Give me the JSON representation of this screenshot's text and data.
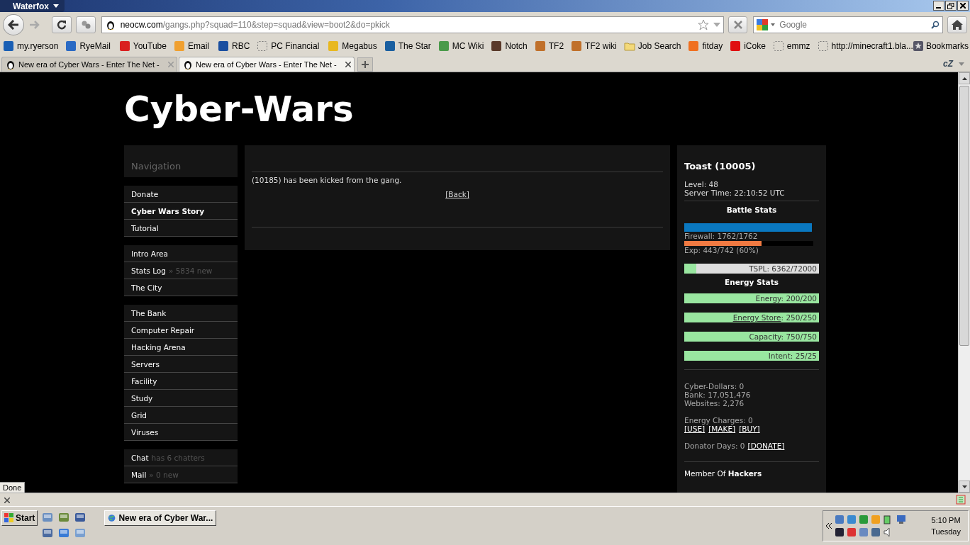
{
  "window": {
    "title": "Waterfox"
  },
  "toolbar": {
    "url_host": "neocw.com",
    "url_path": "/gangs.php?squad=110&step=squad&view=boot2&do=pkick",
    "search_placeholder": "Google"
  },
  "bookmark_groups": [
    [
      {
        "label": "my.ryerson",
        "kind": "favicon",
        "color": "#1a5fb4"
      },
      {
        "label": "RyeMail",
        "kind": "favicon",
        "color": "#2a6ac4"
      }
    ],
    [
      {
        "label": "YouTube",
        "kind": "favicon",
        "color": "#d92020"
      },
      {
        "label": "Email",
        "kind": "favicon",
        "color": "#f0a030"
      }
    ],
    [
      {
        "label": "RBC",
        "kind": "favicon",
        "color": "#1a4fa0"
      },
      {
        "label": "PC Financial",
        "kind": "blank"
      }
    ],
    [
      {
        "label": "Megabus",
        "kind": "favicon",
        "color": "#e8b820"
      },
      {
        "label": "The Star",
        "kind": "favicon",
        "color": "#1a5fa0"
      },
      {
        "label": "MC Wiki",
        "kind": "favicon",
        "color": "#4a9a4a"
      },
      {
        "label": "Notch",
        "kind": "favicon",
        "color": "#5a3a2a"
      },
      {
        "label": "TF2",
        "kind": "favicon",
        "color": "#c0702a"
      },
      {
        "label": "TF2 wiki",
        "kind": "favicon",
        "color": "#c0702a"
      },
      {
        "label": "Job Search",
        "kind": "folder"
      },
      {
        "label": "fitday",
        "kind": "favicon",
        "color": "#f07020"
      },
      {
        "label": "iCoke",
        "kind": "favicon",
        "color": "#e01010"
      },
      {
        "label": "emmz",
        "kind": "blank"
      },
      {
        "label": "http://minecraft1.bla...",
        "kind": "blank"
      }
    ]
  ],
  "bookmarks_menu": "Bookmarks",
  "tabs": [
    {
      "label": "New era of Cyber Wars - Enter The Net -",
      "selected": false
    },
    {
      "label": "New era of Cyber Wars - Enter The Net -",
      "selected": true
    }
  ],
  "addon_badge": "cZ",
  "page": {
    "site_title": "Cyber-Wars",
    "navigation": {
      "heading": "Navigation",
      "groups": [
        [
          {
            "label": "Donate",
            "emphasized": false
          },
          {
            "label": "Cyber Wars Story",
            "emphasized": true
          },
          {
            "label": "Tutorial",
            "emphasized": false
          }
        ],
        [
          {
            "label": "Intro Area",
            "emphasized": false
          },
          {
            "label": "Stats Log",
            "note": "» 5834 new",
            "emphasized": false
          },
          {
            "label": "The City",
            "emphasized": false
          }
        ],
        [
          {
            "label": "The Bank",
            "emphasized": false
          },
          {
            "label": "Computer Repair",
            "emphasized": false
          },
          {
            "label": "Hacking Arena",
            "emphasized": false
          },
          {
            "label": "Servers",
            "emphasized": false
          },
          {
            "label": "Facility",
            "emphasized": false
          },
          {
            "label": "Study",
            "emphasized": false
          },
          {
            "label": "Grid",
            "emphasized": false
          },
          {
            "label": "Viruses",
            "emphasized": false
          }
        ],
        [
          {
            "label": "Chat",
            "note": "has 6 chatters",
            "emphasized": false
          },
          {
            "label": "Mail",
            "note": "» 0 new",
            "emphasized": false
          }
        ]
      ]
    },
    "main": {
      "message": "(10185) has been kicked from the gang.",
      "back_link": "[Back]"
    },
    "profile": {
      "name": "Toast (10005)",
      "level": "Level: 48",
      "server_time": "Server Time: 22:10:52 UTC",
      "battle_heading": "Battle Stats",
      "firewall": {
        "label": "Firewall: 1762/1762",
        "level": 1
      },
      "exp": {
        "label": "Exp: 443/742 (60%)",
        "level": 0.6
      },
      "tspl": {
        "label": "TSPL: 6362/72000",
        "level": 0.088
      },
      "energy_heading": "Energy Stats",
      "energy_bars": [
        {
          "label": "Energy",
          "suffix": ": 200/200",
          "linked": false,
          "level": 1
        },
        {
          "label": "Energy Store",
          "suffix": ": 250/250",
          "linked": true,
          "level": 1
        },
        {
          "label": "Capacity",
          "suffix": ": 750/750",
          "linked": false,
          "level": 1
        },
        {
          "label": "Intent",
          "suffix": ": 25/25",
          "linked": false,
          "level": 1
        }
      ],
      "money": [
        "Cyber-Dollars: 0",
        "Bank: 17,051,476",
        "Websites: 2,276"
      ],
      "energy_charges": "Energy Charges: 0",
      "charge_actions": [
        "[USE]",
        "[MAKE]",
        "[BUY]"
      ],
      "donator_days": "Donator Days: 0",
      "donate_link": "[DONATE]",
      "membership": "Member Of **Hackers**"
    }
  },
  "status": "Done",
  "taskbar": {
    "start": "Start",
    "task": "New era of Cyber War...",
    "time": "5:10 PM",
    "day": "Tuesday"
  }
}
